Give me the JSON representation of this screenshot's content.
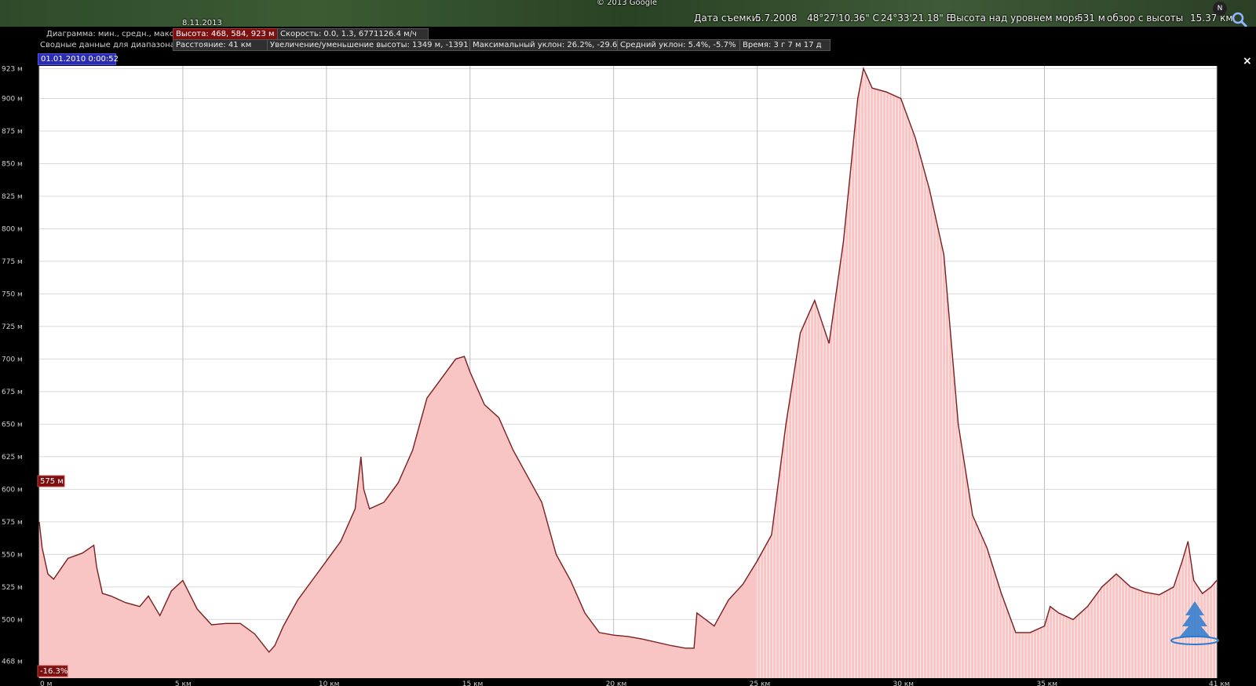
{
  "map_header": {
    "copyright": "© 2013 Google",
    "date_small": "8.11.2013",
    "imagery_date_label": "Дата съемки:",
    "imagery_date": "5.7.2008",
    "lat": "48°27'10.36\" С",
    "lon": "24°33'21.18\" В",
    "elevation_label": "Высота над уровнем моря:",
    "elevation": "531 м",
    "eye_label": "обзор с высоты",
    "eye_alt": "15.37 км",
    "compass_letter": "N"
  },
  "profile_header": {
    "row1_label": "Диаграмма: мин., средн., макс.:",
    "height_box": "Высота: 468, 584, 923 м",
    "speed_box": "Скорость: 0.0, 1.3, 6771126.4 м/ч",
    "row2_label": "Сводные данные для диапазона",
    "distance_box": "Расстояние: 41 км",
    "gain_box": "Увеличение/уменьшение высоты: 1349 м, -1391 м",
    "max_slope_box": "Максимальный уклон: 26.2%, -29.6%",
    "avg_slope_box": "Средний уклон: 5.4%, -5.7%",
    "time_box": "Время: 3 г 7 м 17 д",
    "date_box": "01.01.2010 0:00:52",
    "close": "×"
  },
  "chart_data": {
    "type": "area",
    "x_unit": "км",
    "y_unit": "м",
    "xlim": [
      0,
      41
    ],
    "ylim": [
      455,
      925
    ],
    "x_ticks": [
      0,
      5,
      10,
      15,
      20,
      25,
      30,
      35,
      41
    ],
    "x_tick_labels": [
      "0 м",
      "5 км",
      "10 км",
      "15 км",
      "20 км",
      "25 км",
      "30 км",
      "35 км",
      "41 км"
    ],
    "y_ticks": [
      468,
      500,
      525,
      550,
      575,
      600,
      625,
      650,
      675,
      700,
      725,
      750,
      775,
      800,
      825,
      850,
      875,
      900,
      923
    ],
    "y_tick_labels": [
      "468 м",
      "500 м",
      "525 м",
      "550 м",
      "575 м",
      "600 м",
      "625 м",
      "650 м",
      "675 м",
      "700 м",
      "725 м",
      "750 м",
      "775 м",
      "800 м",
      "825 м",
      "850 м",
      "875 м",
      "900 м",
      "923 м"
    ],
    "grid": true,
    "fill_color": "#f9c4c4",
    "line_color": "#7a1f1f",
    "highlight_start_x": 25,
    "marker_value_label": "575 м",
    "slope_label": "-16.3%",
    "series": [
      {
        "x": [
          0,
          0.1,
          0.3,
          0.5,
          1.0,
          1.5,
          1.9,
          2.0,
          2.2,
          2.5,
          3.0,
          3.5,
          3.8,
          4.2,
          4.6,
          5.0,
          5.5,
          6.0,
          6.5,
          7.0,
          7.5,
          8.0,
          8.2,
          8.5,
          9.0,
          9.5,
          10.0,
          10.5,
          11.0,
          11.2,
          11.3,
          11.5,
          12.0,
          12.5,
          13.0,
          13.5,
          14.0,
          14.5,
          14.8,
          15.0,
          15.5,
          16.0,
          16.5,
          17.0,
          17.5,
          18.0,
          18.5,
          19.0,
          19.5,
          20.0,
          20.5,
          21.0,
          22.0,
          22.5,
          22.8,
          22.9,
          23.5,
          24.0,
          24.5,
          25.0,
          25.5,
          26.0,
          26.5,
          27.0,
          27.5,
          28.0,
          28.5,
          28.7,
          29.0,
          29.5,
          30.0,
          30.5,
          31.0,
          31.5,
          32.0,
          32.5,
          33.0,
          33.5,
          34.0,
          34.5,
          35.0,
          35.2,
          35.5,
          36.0,
          36.5,
          37.0,
          37.5,
          38.0,
          38.5,
          39.0,
          39.5,
          39.8,
          40.0,
          40.2,
          40.5,
          40.8,
          41.0
        ],
        "y": [
          575,
          555,
          535,
          531,
          547,
          551,
          557,
          540,
          520,
          518,
          513,
          510,
          518,
          503,
          522,
          530,
          508,
          496,
          497,
          497,
          489,
          475,
          480,
          495,
          515,
          530,
          545,
          560,
          585,
          625,
          600,
          585,
          590,
          605,
          630,
          670,
          685,
          700,
          702,
          690,
          665,
          655,
          630,
          610,
          590,
          550,
          530,
          505,
          490,
          488,
          487,
          485,
          480,
          478,
          478,
          505,
          495,
          515,
          527,
          545,
          565,
          650,
          720,
          745,
          712,
          790,
          900,
          923,
          908,
          905,
          900,
          870,
          830,
          780,
          650,
          580,
          555,
          520,
          490,
          490,
          495,
          510,
          505,
          500,
          510,
          525,
          535,
          525,
          521,
          519,
          525,
          545,
          560,
          530,
          520,
          525,
          530
        ]
      }
    ]
  }
}
